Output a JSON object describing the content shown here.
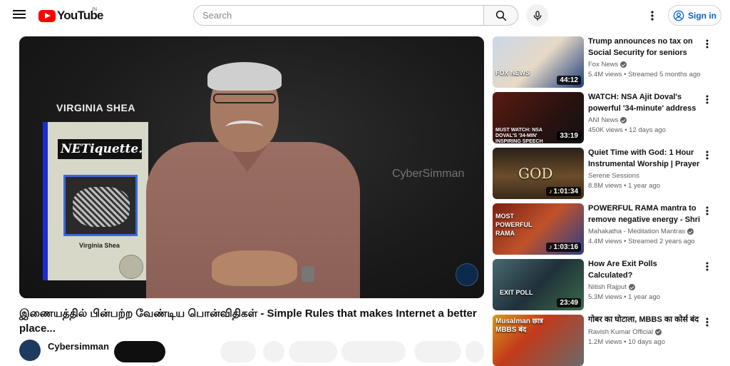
{
  "header": {
    "logo_text": "YouTube",
    "country_code": "IN",
    "search_placeholder": "Search",
    "signin_label": "Sign in"
  },
  "player": {
    "book_title": "VIRGINIA SHEA",
    "book_logo_text": "NETiquette.",
    "book_author": "Virginia Shea",
    "watermark": "CyberSimman"
  },
  "video": {
    "title": "இணையத்தில் பின்பற்ற வேண்டிய பொன்விதிகள் - Simple Rules that makes Internet a better place...",
    "channel": "Cybersimman"
  },
  "recommendations": [
    {
      "title": "Trump announces no tax on Social Security for seniors",
      "channel": "Fox News",
      "verified": true,
      "meta": "5.4M views • Streamed 5 months ago",
      "duration": "44:12",
      "thumb_caption": "FOX NEWS"
    },
    {
      "title": "WATCH: NSA Ajit Doval's powerful '34-minute' address ...",
      "channel": "ANI News",
      "verified": true,
      "meta": "450K views • 12 days ago",
      "duration": "33:19",
      "thumb_caption": "MUST WATCH: NSA DOVAL'S '34-MIN' INSPIRING SPEECH"
    },
    {
      "title": "Quiet Time with God: 1 Hour Instrumental Worship | Prayer ...",
      "channel": "Serene Sessions",
      "verified": false,
      "meta": "8.8M views • 1 year ago",
      "duration": "1:01:34",
      "thumb_caption": "GOD"
    },
    {
      "title": "POWERFUL RAMA mantra to remove negative energy - Shri ...",
      "channel": "Mahakatha - Meditation Mantras",
      "verified": true,
      "meta": "4.4M views • Streamed 2 years ago",
      "duration": "1:03:16",
      "thumb_caption": "MOST POWERFUL RAMA"
    },
    {
      "title": "How Are Exit Polls Calculated?",
      "channel": "Nitish Rajput",
      "verified": true,
      "meta": "5.3M views • 1 year ago",
      "duration": "23:49",
      "thumb_caption": "EXIT POLL"
    },
    {
      "title": "गोबर का घोटाला, MBBS का कोर्स बंद",
      "channel": "Ravish Kumar Official",
      "verified": true,
      "meta": "1.2M views • 10 days ago",
      "duration": "",
      "thumb_caption": "Musalman छात्र MBBS बंद"
    }
  ],
  "icons": {
    "menu": "menu-icon",
    "search": "search-icon",
    "mic": "mic-icon",
    "more": "more-vert-icon",
    "account": "account-circle-icon",
    "verified": "verified-check-icon",
    "music": "music-note-icon"
  },
  "colors": {
    "brand": "#ff0000",
    "link": "#065fd4",
    "text": "#0f0f0f",
    "secondary": "#606060"
  }
}
